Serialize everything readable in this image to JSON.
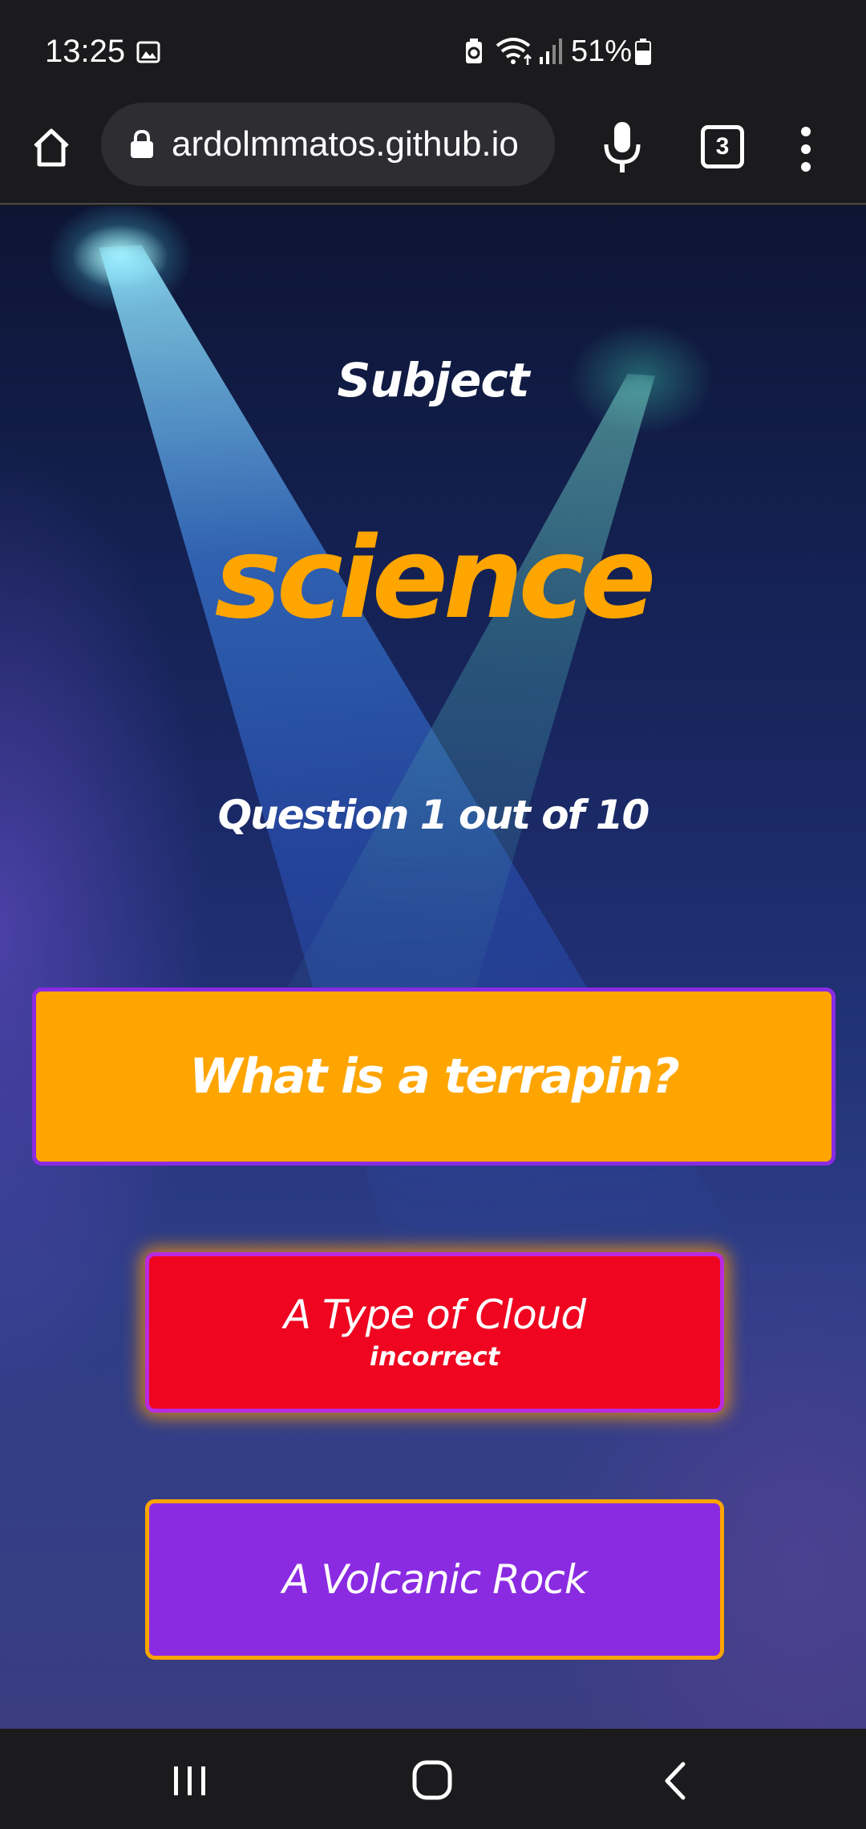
{
  "status_bar": {
    "time": "13:25",
    "battery_percent": "51%",
    "icons": [
      "gallery-icon",
      "battery-saver-icon",
      "wifi-icon",
      "signal-icon",
      "battery-icon"
    ]
  },
  "browser": {
    "url": "ardolmmatos.github.io",
    "tab_count": "3",
    "icons": [
      "home-icon",
      "lock-icon",
      "mic-icon",
      "tabs-icon",
      "more-vert-icon"
    ]
  },
  "quiz": {
    "subject_label": "Subject",
    "subject_value": "science",
    "question_progress": "Question 1 out of 10",
    "question": "What is a terrapin?",
    "answers": [
      {
        "label": "A Type of Cloud",
        "feedback": "incorrect",
        "color": "#ef0520"
      },
      {
        "label": "A Volcanic Rock",
        "feedback": "",
        "color": "#8a2be2"
      }
    ],
    "colors": {
      "accent_orange": "#ffa500",
      "accent_purple": "#8a2be2",
      "incorrect_red": "#ef0520"
    }
  },
  "nav_bar": {
    "icons": [
      "recent-apps-icon",
      "home-icon",
      "back-icon"
    ]
  }
}
